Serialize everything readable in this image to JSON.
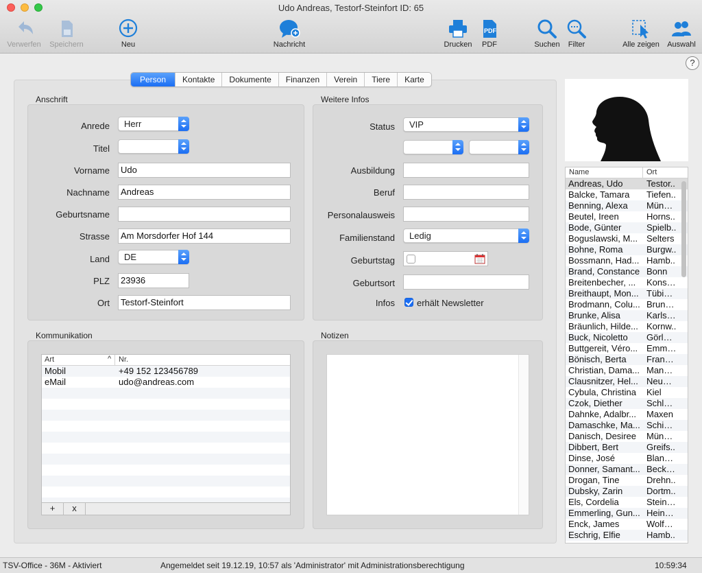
{
  "window": {
    "title": "Udo Andreas, Testorf-Steinfort ID: 65"
  },
  "toolbar": {
    "verwerfen": "Verwerfen",
    "speichern": "Speichern",
    "neu": "Neu",
    "nachricht": "Nachricht",
    "drucken": "Drucken",
    "pdf": "PDF",
    "suchen": "Suchen",
    "filter": "Filter",
    "alle_zeigen": "Alle zeigen",
    "auswahl": "Auswahl",
    "help": "?"
  },
  "tabs": [
    "Person",
    "Kontakte",
    "Dokumente",
    "Finanzen",
    "Verein",
    "Tiere",
    "Karte"
  ],
  "anschrift": {
    "title": "Anschrift",
    "anrede_label": "Anrede",
    "anrede": "Herr",
    "titel_label": "Titel",
    "titel": "",
    "vorname_label": "Vorname",
    "vorname": "Udo",
    "nachname_label": "Nachname",
    "nachname": "Andreas",
    "geburtsname_label": "Geburtsname",
    "geburtsname": "",
    "strasse_label": "Strasse",
    "strasse": "Am Morsdorfer Hof 144",
    "land_label": "Land",
    "land": "DE",
    "plz_label": "PLZ",
    "plz": "23936",
    "ort_label": "Ort",
    "ort": "Testorf-Steinfort"
  },
  "weitere": {
    "title": "Weitere Infos",
    "status_label": "Status",
    "status": "VIP",
    "ausbildung_label": "Ausbildung",
    "beruf_label": "Beruf",
    "personalausweis_label": "Personalausweis",
    "familienstand_label": "Familienstand",
    "familienstand": "Ledig",
    "geburtstag_label": "Geburtstag",
    "geburtsort_label": "Geburtsort",
    "infos_label": "Infos",
    "newsletter_label": "erhält Newsletter",
    "newsletter_checked": true
  },
  "kommunikation": {
    "title": "Kommunikation",
    "col_art": "Art",
    "col_nr": "Nr.",
    "rows": [
      {
        "art": "Mobil",
        "nr": "+49 152 123456789"
      },
      {
        "art": "eMail",
        "nr": "udo@andreas.com"
      }
    ],
    "add": "+",
    "remove": "x"
  },
  "notizen": {
    "title": "Notizen"
  },
  "personlist": {
    "col_name": "Name",
    "col_ort": "Ort",
    "rows": [
      [
        "Andreas, Udo",
        "Testor.."
      ],
      [
        "Balcke, Tamara",
        "Tiefen.."
      ],
      [
        "Benning, Alexa",
        "Münch.."
      ],
      [
        "Beutel, Ireen",
        "Horns.."
      ],
      [
        "Bode, Günter",
        "Spielb.."
      ],
      [
        "Boguslawski, M...",
        "Selters"
      ],
      [
        "Bohne, Roma",
        "Burgw.."
      ],
      [
        "Bossmann, Had...",
        "Hamb.."
      ],
      [
        "Brand, Constance",
        "Bonn"
      ],
      [
        "Breitenbecher, ...",
        "Konsta.."
      ],
      [
        "Breithaupt, Mon...",
        "Tübing.."
      ],
      [
        "Brodmann, Colu...",
        "Brunow"
      ],
      [
        "Brunke, Alisa",
        "Karlsb.."
      ],
      [
        "Bräunlich, Hilde...",
        "Kornw.."
      ],
      [
        "Buck, Nicoletto",
        "Görlsd.."
      ],
      [
        "Buttgereit, Véro...",
        "Emme.."
      ],
      [
        "Bönisch, Berta",
        "Frankf.."
      ],
      [
        "Christian, Dama...",
        "Mannh.."
      ],
      [
        "Clausnitzer, Hel...",
        "Neunk.."
      ],
      [
        "Cybula, Christina",
        "Kiel"
      ],
      [
        "Czok, Diether",
        "Schleuß"
      ],
      [
        "Dahnke, Adalbr...",
        "Maxen"
      ],
      [
        "Damaschke, Ma...",
        "Schind.."
      ],
      [
        "Danisch, Desiree",
        "Münch.."
      ],
      [
        "Dibbert, Bert",
        "Greifs.."
      ],
      [
        "Dinse, José",
        "Blanke.."
      ],
      [
        "Donner, Samant...",
        "Beckum"
      ],
      [
        "Drogan, Tine",
        "Drehn.."
      ],
      [
        "Dubsky, Zarin",
        "Dortm.."
      ],
      [
        "Els, Cordelia",
        "Steinw.."
      ],
      [
        "Emmerling, Gun...",
        "Heiner.."
      ],
      [
        "Enck, James",
        "Wolfsb.."
      ],
      [
        "Eschrig, Elfie",
        "Hamb.."
      ]
    ]
  },
  "statusbar": {
    "left": "TSV-Office - 36M - Aktiviert",
    "center": "Angemeldet seit 19.12.19, 10:57 als 'Administrator' mit Administrationsberechtigung",
    "time": "10:59:34"
  },
  "colors": {
    "accent": "#1b6ef3",
    "icon": "#1e7fd9"
  }
}
